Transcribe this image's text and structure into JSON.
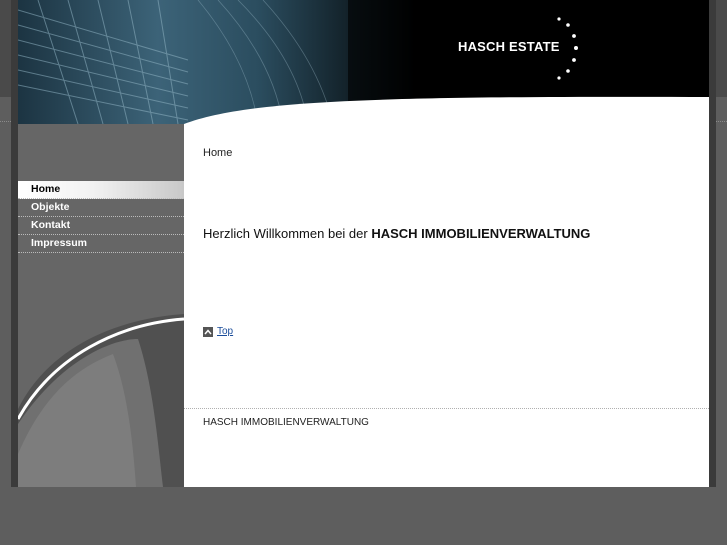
{
  "header": {
    "logo_text": "HASCH ESTATE"
  },
  "nav": {
    "items": [
      {
        "label": "Home",
        "active": true
      },
      {
        "label": "Objekte",
        "active": false
      },
      {
        "label": "Kontakt",
        "active": false
      },
      {
        "label": "Impressum",
        "active": false
      }
    ]
  },
  "content": {
    "breadcrumb": "Home",
    "welcome_prefix": "Herzlich Willkommen bei der",
    "welcome_company": "HASCH IMMOBILIENVERWALTUNG",
    "top_link": "Top"
  },
  "footer": {
    "text": "HASCH IMMOBILIENVERWALTUNG"
  },
  "colors": {
    "background": "#5e5e5e",
    "header": "#000000",
    "sidebar": "#666666",
    "content": "#ffffff",
    "link": "#1a4c9a"
  }
}
